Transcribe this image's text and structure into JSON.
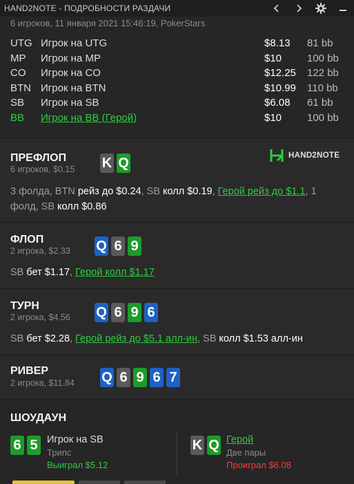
{
  "window": {
    "title": "HAND2NOTE - ПОДРОБНОСТИ РАЗДАЧИ"
  },
  "icons": {
    "prev": "chevron-left-icon",
    "next": "chevron-right-icon",
    "settings": "gear-icon",
    "minimize": "minimize-icon"
  },
  "hand": {
    "summary": "6 игроков, 11 января 2021 15:46:19, PokerStars"
  },
  "players": [
    {
      "pos": "UTG",
      "name": "Игрок на UTG",
      "stack": "$8.13",
      "bb": "81 bb"
    },
    {
      "pos": "MP",
      "name": "Игрок на MP",
      "stack": "$10",
      "bb": "100 bb"
    },
    {
      "pos": "CO",
      "name": "Игрок на CO",
      "stack": "$12.25",
      "bb": "122 bb"
    },
    {
      "pos": "BTN",
      "name": "Игрок на BTN",
      "stack": "$10.99",
      "bb": "110 bb"
    },
    {
      "pos": "SB",
      "name": "Игрок на SB",
      "stack": "$6.08",
      "bb": "61 bb"
    },
    {
      "pos": "BB",
      "name": "Игрок на BB (Герой)",
      "stack": "$10",
      "bb": "100 bb"
    }
  ],
  "preflop": {
    "title": "ПРЕФЛОП",
    "info": "6 игроков, $0.15",
    "cards": [
      {
        "rank": "K",
        "suit": "s"
      },
      {
        "rank": "Q",
        "suit": "c"
      }
    ],
    "logo": "HAND2NOTE",
    "actions": [
      {
        "t": "3 фолда, BTN ",
        "k": "n"
      },
      {
        "t": "рейз до $0.24",
        "k": "b"
      },
      {
        "t": ", SB ",
        "k": "n"
      },
      {
        "t": "колл $0.19",
        "k": "b"
      },
      {
        "t": ", ",
        "k": "n"
      },
      {
        "t": "Герой рейз до $1.1",
        "k": "h"
      },
      {
        "t": ", 1 фолд, SB ",
        "k": "n"
      },
      {
        "t": "колл $0.86",
        "k": "b"
      }
    ]
  },
  "flop": {
    "title": "ФЛОП",
    "info": "2 игрока, $2.33",
    "cards": [
      {
        "rank": "Q",
        "suit": "d"
      },
      {
        "rank": "6",
        "suit": "s"
      },
      {
        "rank": "9",
        "suit": "c"
      }
    ],
    "actions": [
      {
        "t": "SB ",
        "k": "n"
      },
      {
        "t": "бет $1.17",
        "k": "b"
      },
      {
        "t": ", ",
        "k": "n"
      },
      {
        "t": "Герой колл $1.17",
        "k": "h"
      }
    ]
  },
  "turn": {
    "title": "ТУРН",
    "info": "2 игрока, $4.56",
    "cards": [
      {
        "rank": "Q",
        "suit": "d"
      },
      {
        "rank": "6",
        "suit": "s"
      },
      {
        "rank": "9",
        "suit": "c"
      },
      {
        "rank": "6",
        "suit": "d"
      }
    ],
    "actions": [
      {
        "t": "SB ",
        "k": "n"
      },
      {
        "t": "бет $2.28",
        "k": "b"
      },
      {
        "t": ", ",
        "k": "n"
      },
      {
        "t": "Герой рейз до $5.1 алл-ин",
        "k": "h"
      },
      {
        "t": ", SB ",
        "k": "n"
      },
      {
        "t": "колл $1.53 алл-ин",
        "k": "b"
      }
    ]
  },
  "river": {
    "title": "РИВЕР",
    "info": "2 игрока, $11.84",
    "cards": [
      {
        "rank": "Q",
        "suit": "d"
      },
      {
        "rank": "6",
        "suit": "s"
      },
      {
        "rank": "9",
        "suit": "c"
      },
      {
        "rank": "6",
        "suit": "d"
      },
      {
        "rank": "7",
        "suit": "d"
      }
    ]
  },
  "showdown": {
    "title": "ШОУДАУН",
    "left": {
      "cards": [
        {
          "rank": "6",
          "suit": "c"
        },
        {
          "rank": "5",
          "suit": "c"
        }
      ],
      "name": "Игрок на SB",
      "hand": "Трипс",
      "result": "Выиграл $5.12"
    },
    "right": {
      "cards": [
        {
          "rank": "K",
          "suit": "s"
        },
        {
          "rank": "Q",
          "suit": "c"
        }
      ],
      "name": "Герой",
      "hand": "Две пары",
      "result": "Проиграл $6.08"
    }
  },
  "colors": {
    "spade": "#5a5a5a",
    "heart": "#d11a1a",
    "diamond": "#1d62c6",
    "club": "#1c9c2b",
    "hero": "#2ecc40",
    "lost": "#ff3b3b"
  }
}
